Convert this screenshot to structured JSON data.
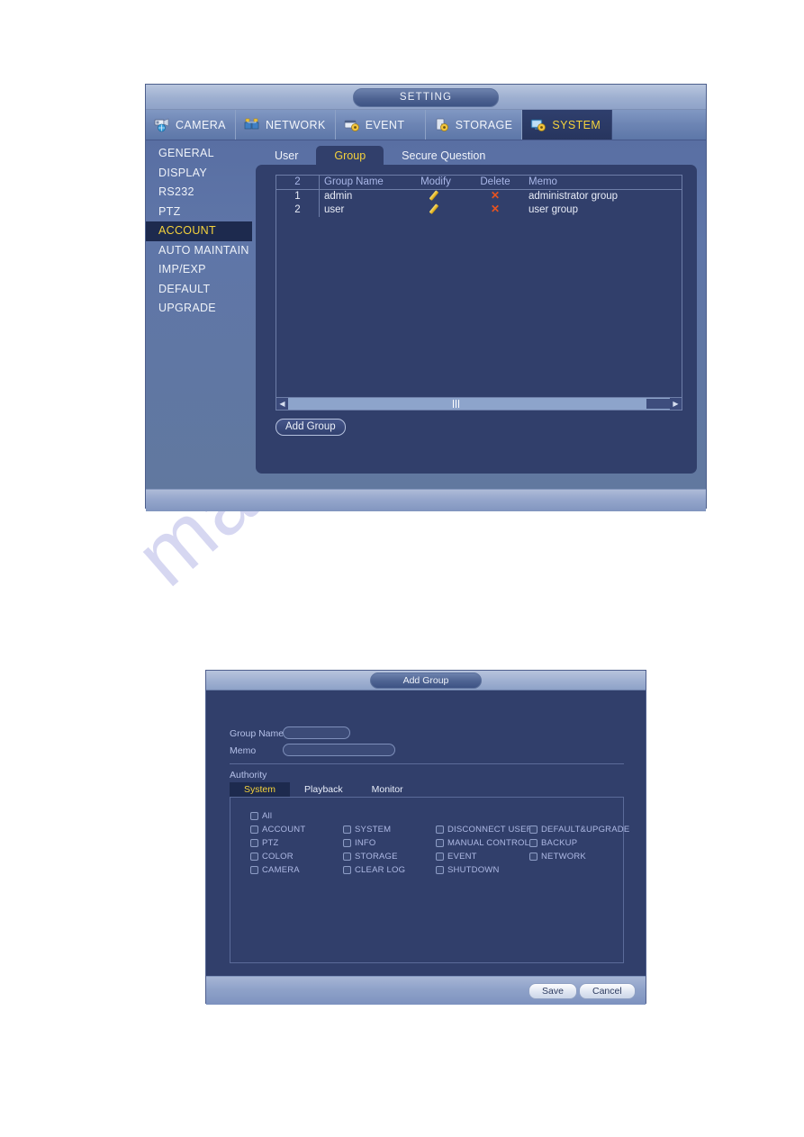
{
  "watermark": {
    "text": "manualshive.com"
  },
  "main_window": {
    "title": "SETTING",
    "top_tabs": [
      {
        "label": "CAMERA",
        "icon": "camera-icon",
        "active": false
      },
      {
        "label": "NETWORK",
        "icon": "network-icon",
        "active": false
      },
      {
        "label": "EVENT",
        "icon": "event-icon",
        "active": false
      },
      {
        "label": "STORAGE",
        "icon": "storage-icon",
        "active": false
      },
      {
        "label": "SYSTEM",
        "icon": "system-icon",
        "active": true
      }
    ],
    "sidebar": {
      "items": [
        {
          "label": "GENERAL",
          "active": false
        },
        {
          "label": "DISPLAY",
          "active": false
        },
        {
          "label": "RS232",
          "active": false
        },
        {
          "label": "PTZ",
          "active": false
        },
        {
          "label": "ACCOUNT",
          "active": true
        },
        {
          "label": "AUTO MAINTAIN",
          "active": false
        },
        {
          "label": "IMP/EXP",
          "active": false
        },
        {
          "label": "DEFAULT",
          "active": false
        },
        {
          "label": "UPGRADE",
          "active": false
        }
      ]
    },
    "sub_tabs": [
      {
        "label": "User",
        "active": false
      },
      {
        "label": "Group",
        "active": true
      },
      {
        "label": "Secure Question",
        "active": false
      }
    ],
    "table": {
      "headers": [
        "2",
        "Group Name",
        "Modify",
        "Delete",
        "Memo"
      ],
      "rows": [
        {
          "index": "1",
          "group_name": "admin",
          "modify_icon": "pencil-icon",
          "delete_icon": "cross-icon",
          "memo": "administrator group"
        },
        {
          "index": "2",
          "group_name": "user",
          "modify_icon": "pencil-icon",
          "delete_icon": "cross-icon",
          "memo": "user group"
        }
      ]
    },
    "add_group_button": "Add Group"
  },
  "add_group_dialog": {
    "title": "Add Group",
    "group_name": {
      "label": "Group Name",
      "value": "",
      "placeholder": ""
    },
    "memo": {
      "label": "Memo",
      "value": "",
      "placeholder": ""
    },
    "authority_label": "Authority",
    "authority_tabs": [
      {
        "label": "System",
        "active": true
      },
      {
        "label": "Playback",
        "active": false
      },
      {
        "label": "Monitor",
        "active": false
      }
    ],
    "permissions": {
      "all": {
        "label": "All",
        "checked": false
      },
      "columns": [
        [
          {
            "label": "ACCOUNT",
            "checked": false
          },
          {
            "label": "PTZ",
            "checked": false
          },
          {
            "label": "COLOR",
            "checked": false
          },
          {
            "label": "CAMERA",
            "checked": false
          }
        ],
        [
          {
            "label": "SYSTEM",
            "checked": false
          },
          {
            "label": "INFO",
            "checked": false
          },
          {
            "label": "STORAGE",
            "checked": false
          },
          {
            "label": "CLEAR LOG",
            "checked": false
          }
        ],
        [
          {
            "label": "DISCONNECT USER",
            "checked": false
          },
          {
            "label": "MANUAL CONTROL",
            "checked": false
          },
          {
            "label": "EVENT",
            "checked": false
          },
          {
            "label": "SHUTDOWN",
            "checked": false
          }
        ],
        [
          {
            "label": "DEFAULT&UPGRADE",
            "checked": false
          },
          {
            "label": "BACKUP",
            "checked": false
          },
          {
            "label": "NETWORK",
            "checked": false
          }
        ]
      ]
    },
    "save_button": "Save",
    "cancel_button": "Cancel"
  },
  "colors": {
    "accent_yellow": "#f4d23c",
    "panel_blue": "#313f6b",
    "window_blue": "#5f76a8",
    "delete_red": "#e8531f",
    "pencil_yellow": "#e8bb2a"
  }
}
